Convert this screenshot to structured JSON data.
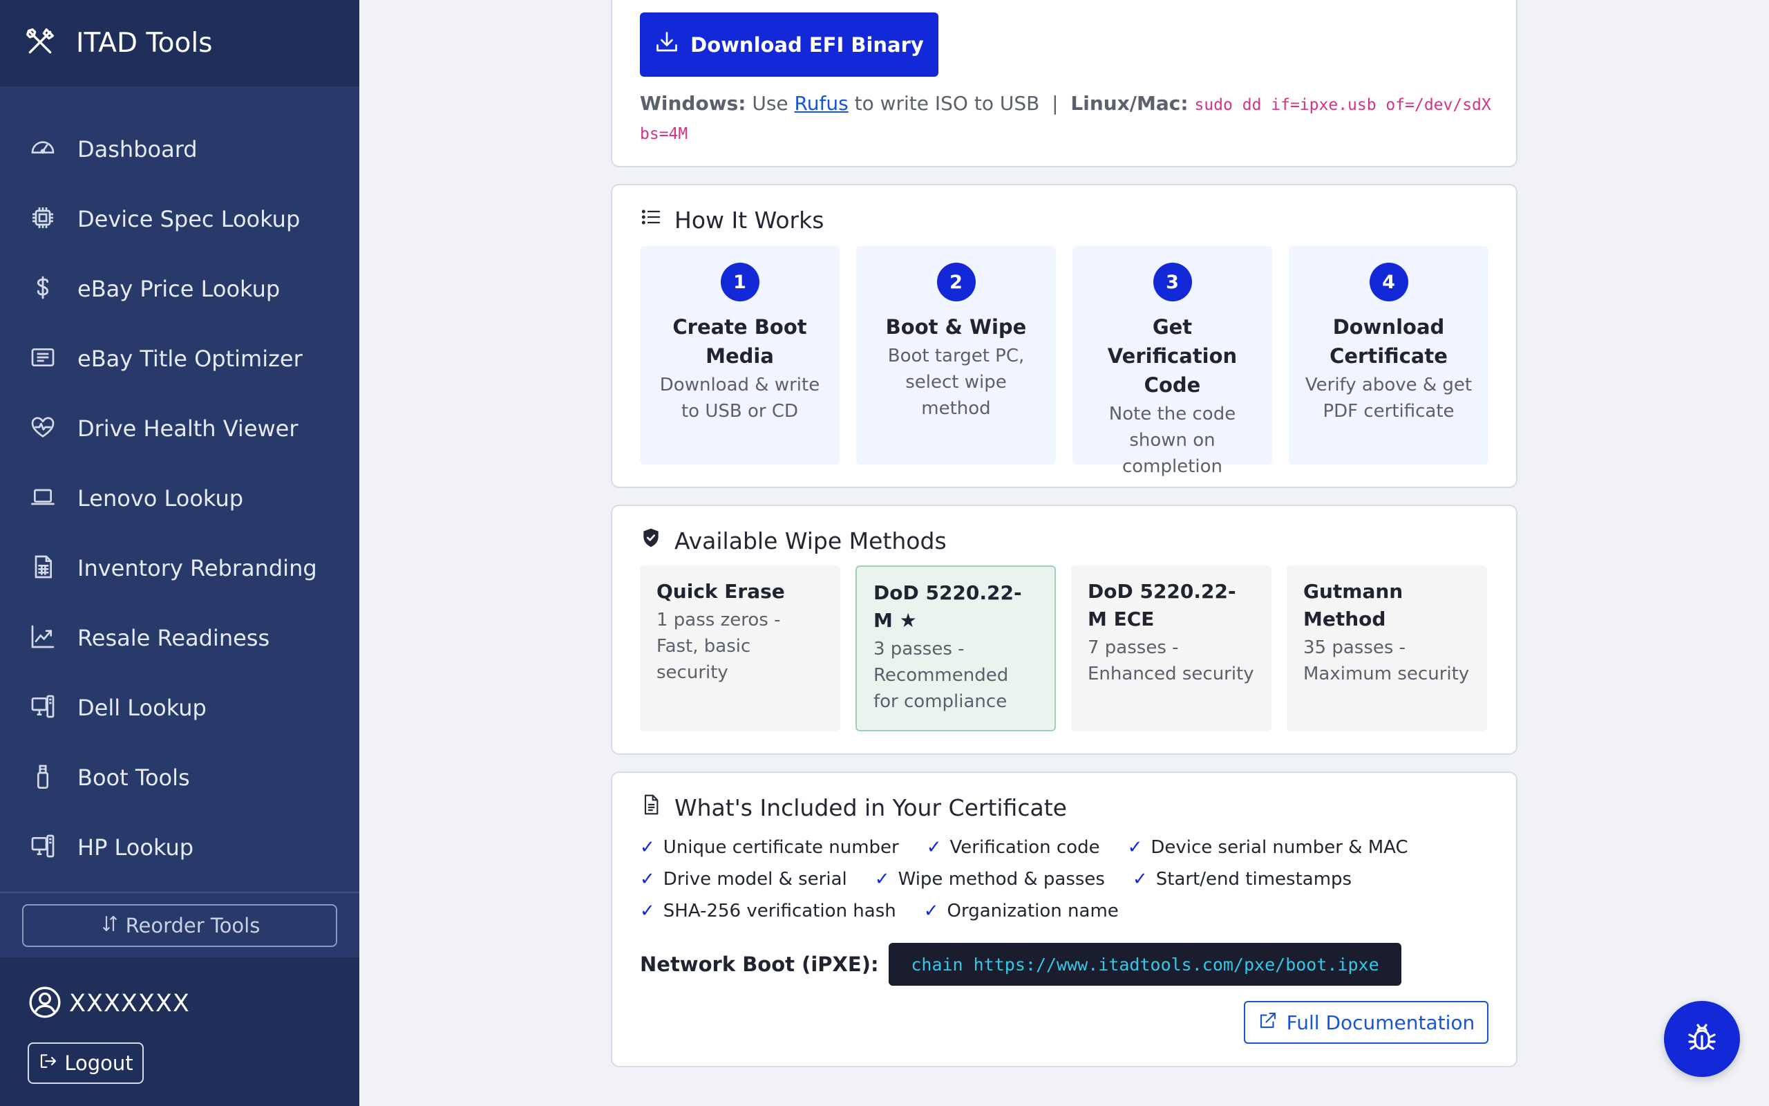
{
  "brand": {
    "title": "ITAD Tools"
  },
  "sidebar": {
    "items": [
      {
        "label": "Dashboard",
        "icon": "speedometer-icon"
      },
      {
        "label": "Device Spec Lookup",
        "icon": "cpu-icon"
      },
      {
        "label": "eBay Price Lookup",
        "icon": "dollar-icon"
      },
      {
        "label": "eBay Title Optimizer",
        "icon": "card-text-icon"
      },
      {
        "label": "Drive Health Viewer",
        "icon": "heart-pulse-icon"
      },
      {
        "label": "Lenovo Lookup",
        "icon": "laptop-icon"
      },
      {
        "label": "Inventory Rebranding",
        "icon": "spreadsheet-icon"
      },
      {
        "label": "Resale Readiness",
        "icon": "graph-up-icon"
      },
      {
        "label": "Dell Lookup",
        "icon": "pc-display-icon"
      },
      {
        "label": "Boot Tools",
        "icon": "usb-drive-icon"
      },
      {
        "label": "HP Lookup",
        "icon": "pc-display-icon"
      }
    ],
    "reorder_label": "Reorder Tools",
    "username": "XXXXXXX",
    "logout_label": "Logout"
  },
  "download": {
    "button_label": "Download EFI Binary",
    "windows_label": "Windows:",
    "windows_pre": " Use ",
    "rufus_link": "Rufus",
    "windows_post": " to write ISO to USB ",
    "separator": "|",
    "linux_label": "Linux/Mac:",
    "linux_cmd": "sudo dd if=ipxe.usb of=/dev/sdX bs=4M"
  },
  "how": {
    "title": "How It Works",
    "steps": [
      {
        "num": "1",
        "title": "Create Boot Media",
        "desc": "Download & write to USB or CD"
      },
      {
        "num": "2",
        "title": "Boot & Wipe",
        "desc": "Boot target PC, select wipe method"
      },
      {
        "num": "3",
        "title": "Get Verification Code",
        "desc": "Note the code shown on completion"
      },
      {
        "num": "4",
        "title": "Download Certificate",
        "desc": "Verify above & get PDF certificate"
      }
    ]
  },
  "wipe": {
    "title": "Available Wipe Methods",
    "methods": [
      {
        "name": "Quick Erase",
        "desc": "1 pass zeros - Fast, basic security"
      },
      {
        "name": "DoD 5220.22-M ★",
        "desc": "3 passes - Recommended for compliance"
      },
      {
        "name": "DoD 5220.22-M ECE",
        "desc": "7 passes - Enhanced security"
      },
      {
        "name": "Gutmann Method",
        "desc": "35 passes - Maximum security"
      }
    ]
  },
  "cert": {
    "title": "What's Included in Your Certificate",
    "check": "✓",
    "items": [
      "Unique certificate number",
      "Verification code",
      "Device serial number & MAC",
      "Drive model & serial",
      "Wipe method & passes",
      "Start/end timestamps",
      "SHA-256 verification hash",
      "Organization name"
    ],
    "pxe_label": "Network Boot (iPXE):",
    "pxe_cmd": "chain https://www.itadtools.com/pxe/boot.ipxe",
    "docs_label": "Full Documentation"
  },
  "colors": {
    "sidebar_bg": "#283a69",
    "accent": "#1329d8",
    "link": "#1654d8",
    "code_pink": "#d63384",
    "code_cyan": "#35c7e8"
  }
}
